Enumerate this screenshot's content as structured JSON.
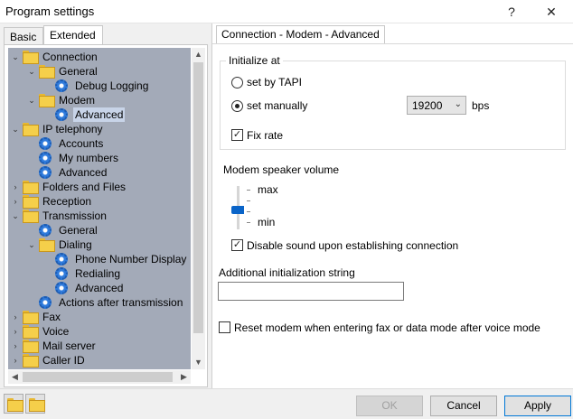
{
  "window": {
    "title": "Program settings",
    "help_glyph": "?",
    "close_glyph": "✕"
  },
  "tabs": {
    "basic": "Basic",
    "extended": "Extended"
  },
  "tree": {
    "items": [
      {
        "label": "Connection",
        "icon": "folder-icon",
        "expander": "⌄"
      },
      {
        "label": "General",
        "icon": "folder-icon",
        "expander": "⌄"
      },
      {
        "label": "Debug Logging",
        "icon": "gear-icon",
        "expander": ""
      },
      {
        "label": "Modem",
        "icon": "folder-icon",
        "expander": "⌄"
      },
      {
        "label": "Advanced",
        "icon": "gear-icon",
        "expander": ""
      },
      {
        "label": "IP telephony",
        "icon": "folder-icon",
        "expander": "⌄"
      },
      {
        "label": "Accounts",
        "icon": "gear-icon",
        "expander": ""
      },
      {
        "label": "My numbers",
        "icon": "gear-icon",
        "expander": ""
      },
      {
        "label": "Advanced",
        "icon": "gear-icon",
        "expander": ""
      },
      {
        "label": "Folders and Files",
        "icon": "folder-icon",
        "expander": "›"
      },
      {
        "label": "Reception",
        "icon": "folder-icon",
        "expander": "›"
      },
      {
        "label": "Transmission",
        "icon": "folder-icon",
        "expander": "⌄"
      },
      {
        "label": "General",
        "icon": "gear-icon",
        "expander": ""
      },
      {
        "label": "Dialing",
        "icon": "folder-icon",
        "expander": "⌄"
      },
      {
        "label": "Phone Number Display",
        "icon": "gear-icon",
        "expander": ""
      },
      {
        "label": "Redialing",
        "icon": "gear-icon",
        "expander": ""
      },
      {
        "label": "Advanced",
        "icon": "gear-icon",
        "expander": ""
      },
      {
        "label": "Actions after transmission",
        "icon": "gear-icon",
        "expander": ""
      },
      {
        "label": "Fax",
        "icon": "folder-icon",
        "expander": "›"
      },
      {
        "label": "Voice",
        "icon": "folder-icon",
        "expander": "›"
      },
      {
        "label": "Mail server",
        "icon": "folder-icon",
        "expander": "›"
      },
      {
        "label": "Caller ID",
        "icon": "folder-icon",
        "expander": "›"
      }
    ],
    "scroll_up": "▲",
    "scroll_down": "▼",
    "scroll_left": "◀",
    "scroll_right": "▶"
  },
  "panel": {
    "tab_title": "Connection - Modem - Advanced",
    "initialize": {
      "title": "Initialize at",
      "tapi_label": "set by TAPI",
      "manual_label": "set manually",
      "speed_value": "19200",
      "speed_unit": "bps",
      "combo_arrow": "⌄",
      "fix_rate_label": "Fix rate",
      "check_mark": "✓"
    },
    "speaker": {
      "title": "Modem speaker volume",
      "max_label": "max",
      "min_label": "min",
      "level": 0.33,
      "disable_sound_label": "Disable sound upon establishing connection"
    },
    "init_string": {
      "label": "Additional initialization string",
      "value": ""
    },
    "reset_label": "Reset modem when entering fax or data mode after voice mode"
  },
  "buttons": {
    "ok": "OK",
    "cancel": "Cancel",
    "apply": "Apply"
  },
  "colors": {
    "tree_background": "#a3aab8",
    "accent": "#0a64c8",
    "selection": "#c8d4e8"
  }
}
